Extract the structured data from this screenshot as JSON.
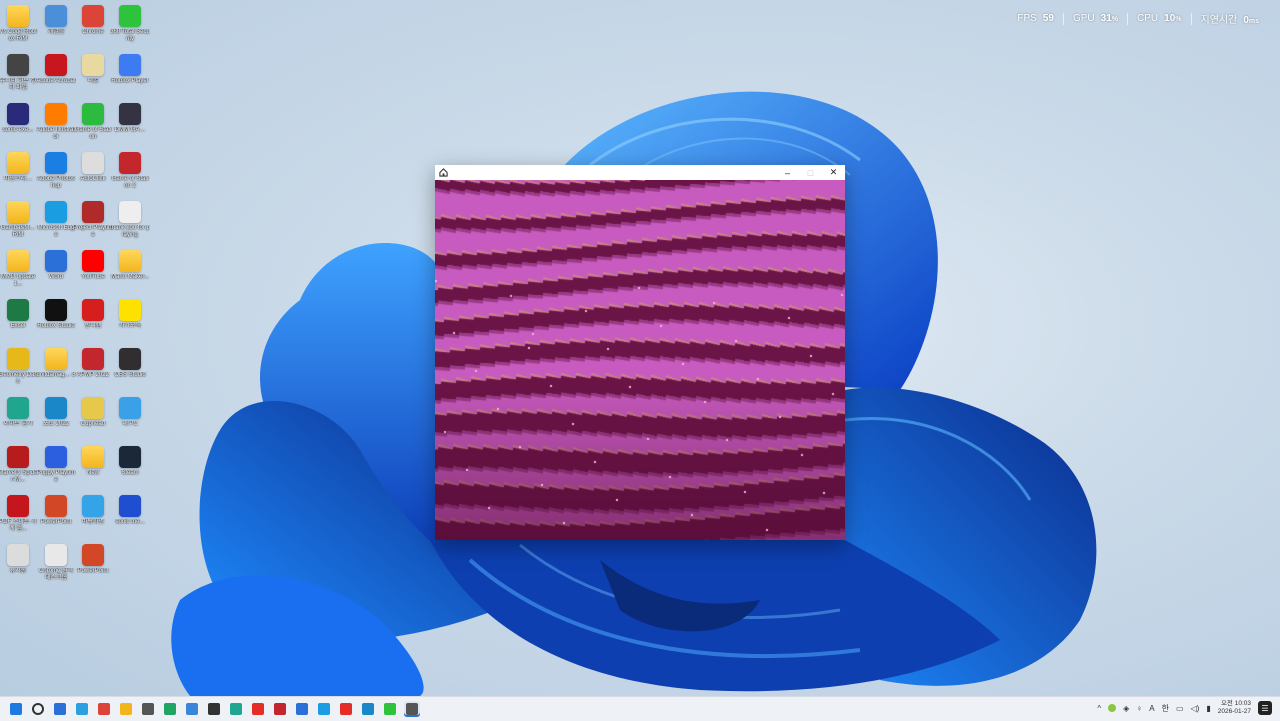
{
  "overlay": {
    "fps_label": "FPS",
    "fps_value": "59",
    "gpu_label": "GPU",
    "gpu_value": "31",
    "gpu_unit": "%",
    "cpu_label": "CPU",
    "cpu_value": "10",
    "cpu_unit": "%",
    "latency_label": "지연시간",
    "latency_value": "0",
    "latency_unit": "ms"
  },
  "desktop_icons": [
    {
      "label": "Vs Code Roblox RiM",
      "icon": "folder-icon",
      "color": "#f3b51c"
    },
    {
      "label": "개발툴",
      "icon": "app-icon",
      "color": "#4a8fd8"
    },
    {
      "label": "Chrome",
      "icon": "chrome-icon",
      "color": "#db4437"
    },
    {
      "label": "360 Total Security",
      "icon": "security-icon",
      "color": "#2ec33d"
    },
    {
      "label": "유니티 허브 설치 파일",
      "icon": "unity-icon",
      "color": "#444444"
    },
    {
      "label": "Adobe Acrobat",
      "icon": "acrobat-icon",
      "color": "#c7161d"
    },
    {
      "label": "너굴",
      "icon": "character-icon",
      "color": "#e8d9a0"
    },
    {
      "label": "Roblox Player",
      "icon": "roblox-player-icon",
      "color": "#3d7bf2"
    },
    {
      "label": "sonic-exe...",
      "icon": "game-icon",
      "color": "#2a2a7a"
    },
    {
      "label": "Adobe Illustrator",
      "icon": "illustrator-icon",
      "color": "#ff7c00"
    },
    {
      "label": "Game of Station",
      "icon": "game-icon",
      "color": "#2dbb3f"
    },
    {
      "label": "DMM GA…",
      "icon": "game-icon",
      "color": "#333344"
    },
    {
      "label": "마인크래…",
      "icon": "folder-icon",
      "color": "#f3b51c"
    },
    {
      "label": "Adobe Photoshop",
      "icon": "photoshop-icon",
      "color": "#1a7ee3"
    },
    {
      "label": "AutoClick",
      "icon": "mouse-icon",
      "color": "#dddddd"
    },
    {
      "label": "Game of Station 2",
      "icon": "game-icon",
      "color": "#c4262e"
    },
    {
      "label": "Gamba&M… RiM",
      "icon": "folder-icon",
      "color": "#f3b51c"
    },
    {
      "label": "Microsoft Edge",
      "icon": "edge-icon",
      "color": "#1b9de2"
    },
    {
      "label": "Project Playtime",
      "icon": "game-icon",
      "color": "#b02a2a"
    },
    {
      "label": "thank you for playing",
      "icon": "file-icon",
      "color": "#eeeeee"
    },
    {
      "label": "MMD update 1...",
      "icon": "folder-icon",
      "color": "#f3b51c"
    },
    {
      "label": "Word",
      "icon": "word-icon",
      "color": "#2b6fd8"
    },
    {
      "label": "YouTube",
      "icon": "youtube-icon",
      "color": "#ff0000"
    },
    {
      "label": "Mario Maker...",
      "icon": "folder-icon",
      "color": "#f3b51c"
    },
    {
      "label": "Excel",
      "icon": "excel-icon",
      "color": "#1d7a44"
    },
    {
      "label": "Roblox Studio",
      "icon": "roblox-studio-icon",
      "color": "#111111"
    },
    {
      "label": "반디캠",
      "icon": "record-icon",
      "color": "#d61e1e"
    },
    {
      "label": "카카오톡",
      "icon": "kakaotalk-icon",
      "color": "#ffe100"
    },
    {
      "label": "Geometry Dash",
      "icon": "geometry-dash-icon",
      "color": "#e7b81a"
    },
    {
      "label": "unitdamag… 8",
      "icon": "folder-icon",
      "color": "#f3b51c"
    },
    {
      "label": "APMP 2022",
      "icon": "app-icon",
      "color": "#c4262e"
    },
    {
      "label": "OBS Studio",
      "icon": "obs-icon",
      "color": "#302e31"
    },
    {
      "label": "씨이트 넘기",
      "icon": "app-icon",
      "color": "#20a58f"
    },
    {
      "label": "포토 2022",
      "icon": "photo-icon",
      "color": "#1a87c9"
    },
    {
      "label": "Cuphead",
      "icon": "cuphead-icon",
      "color": "#e6c94a"
    },
    {
      "label": "내 PC",
      "icon": "pc-icon",
      "color": "#3aa0e8"
    },
    {
      "label": "Marvel's Spider-M...",
      "icon": "spiderman-icon",
      "color": "#b71c1c"
    },
    {
      "label": "Poppy Playtime",
      "icon": "poppy-icon",
      "color": "#2b5fe0"
    },
    {
      "label": "New",
      "icon": "folder-icon",
      "color": "#f3b51c"
    },
    {
      "label": "Steam",
      "icon": "steam-icon",
      "color": "#1b2838"
    },
    {
      "label": "PDF 스마트 시계 앱...",
      "icon": "pdf-icon",
      "color": "#c4161c"
    },
    {
      "label": "PowerPoint",
      "icon": "powerpoint-icon",
      "color": "#d24726"
    },
    {
      "label": "바탕화면",
      "icon": "desktop-icon",
      "color": "#35a3e8"
    },
    {
      "label": "sonic the...",
      "icon": "sonic-icon",
      "color": "#1f4fd0"
    },
    {
      "label": "휴지통",
      "icon": "recycle-bin-icon",
      "color": "#dcdcdc"
    },
    {
      "label": "Chrome 원격 데스크톱",
      "icon": "remote-desktop-icon",
      "color": "#e8e8e8"
    },
    {
      "label": "PowerPoint",
      "icon": "powerpoint-icon",
      "color": "#d24726"
    }
  ],
  "app_window": {
    "minimize": "–",
    "maximize": "□",
    "close": "✕",
    "canvas_colors": {
      "light": "#c75bbf",
      "mid": "#9a3b86",
      "dark": "#6b1447",
      "edge": "#c98a7e"
    }
  },
  "taskbar": {
    "apps": [
      {
        "icon": "start-icon",
        "color": "#1e79e0"
      },
      {
        "icon": "search-icon",
        "color": "#333333"
      },
      {
        "icon": "task-view-icon",
        "color": "#2b6fd8"
      },
      {
        "icon": "widgets-icon",
        "color": "#2aa0e0"
      },
      {
        "icon": "chrome-icon",
        "color": "#db4437"
      },
      {
        "icon": "file-explorer-icon",
        "color": "#f3b51c"
      },
      {
        "icon": "app-icon",
        "color": "#555555"
      },
      {
        "icon": "app-icon",
        "color": "#1fa463"
      },
      {
        "icon": "app-icon",
        "color": "#3a86d8"
      },
      {
        "icon": "app-icon",
        "color": "#333333"
      },
      {
        "icon": "app-icon",
        "color": "#20a58f"
      },
      {
        "icon": "youtube-icon",
        "color": "#e52d27"
      },
      {
        "icon": "app-icon",
        "color": "#c4262e"
      },
      {
        "icon": "app-icon",
        "color": "#2b6fd8"
      },
      {
        "icon": "edge-icon",
        "color": "#1b9de2"
      },
      {
        "icon": "youtube-icon",
        "color": "#e52d27"
      },
      {
        "icon": "app-icon",
        "color": "#1a87c9"
      },
      {
        "icon": "app-icon",
        "color": "#2ec33d"
      },
      {
        "icon": "roblox-studio-icon",
        "color": "#555555",
        "active": true
      }
    ],
    "tray": {
      "ime": "A",
      "lang": "한",
      "time": "오전 10:03",
      "date": "2026-01-27"
    }
  }
}
